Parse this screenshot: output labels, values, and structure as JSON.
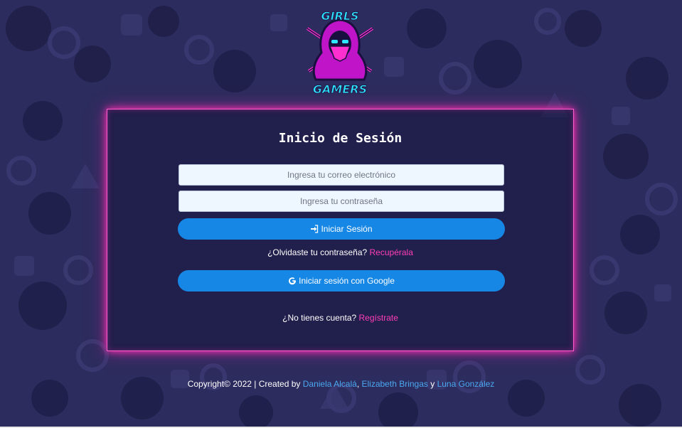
{
  "brand": {
    "logo_top_text": "GIRLS",
    "logo_bottom_text": "GAMERS"
  },
  "login": {
    "title": "Inicio de Sesión",
    "email_placeholder": "Ingresa tu correo electrónico",
    "password_placeholder": "Ingresa tu contraseña",
    "submit_label": "Iniciar Sesión",
    "forgot_prompt": "¿Olvidaste tu contraseña?",
    "forgot_link": "Recupérala",
    "google_label": "Iniciar sesión con Google",
    "no_account_prompt": "¿No tienes cuenta?",
    "register_link": "Regístrate"
  },
  "footer": {
    "copyright": "Copyright© 2022 | Created by",
    "authors": [
      "Daniela Alcalá",
      "Elizabeth Bringas",
      "Luna González"
    ],
    "separator": ",",
    "conjunction": "y"
  },
  "colors": {
    "accent_pink": "#ff3fb8",
    "button_blue": "#1687e5",
    "link_blue": "#4aa8f0",
    "background": "#2a2a5a"
  },
  "icons": [
    "sign-in-icon",
    "google-icon"
  ]
}
